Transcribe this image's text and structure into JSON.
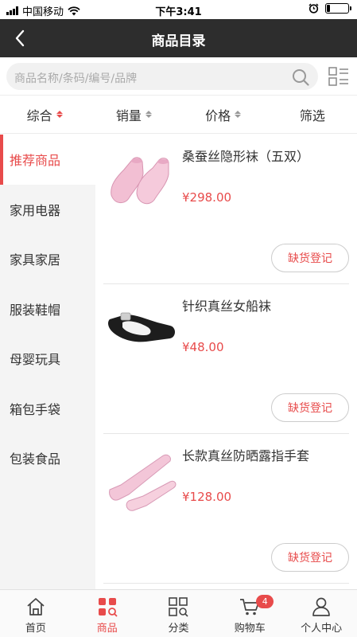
{
  "status_bar": {
    "carrier": "中国移动",
    "time": "下午3:41"
  },
  "nav": {
    "title": "商品目录"
  },
  "search": {
    "placeholder": "商品名称/条码/编号/品牌"
  },
  "sort": {
    "items": [
      {
        "label": "综合",
        "active": true
      },
      {
        "label": "销量"
      },
      {
        "label": "价格"
      },
      {
        "label": "筛选"
      }
    ]
  },
  "categories": [
    {
      "label": "推荐商品",
      "active": true
    },
    {
      "label": "家用电器"
    },
    {
      "label": "家具家居"
    },
    {
      "label": "服装鞋帽"
    },
    {
      "label": "母婴玩具"
    },
    {
      "label": "箱包手袋"
    },
    {
      "label": "包装食品"
    }
  ],
  "products": [
    {
      "name": "桑蚕丝隐形袜（五双）",
      "price": "¥298.00",
      "button": "缺货登记"
    },
    {
      "name": "针织真丝女船袜",
      "price": "¥48.00",
      "button": "缺货登记"
    },
    {
      "name": "长款真丝防晒露指手套",
      "price": "¥128.00",
      "button": "缺货登记"
    }
  ],
  "tabbar": {
    "items": [
      {
        "label": "首页"
      },
      {
        "label": "商品",
        "active": true
      },
      {
        "label": "分类"
      },
      {
        "label": "购物车",
        "badge": "4"
      },
      {
        "label": "个人中心"
      }
    ]
  },
  "colors": {
    "accent": "#e84b4b",
    "navbar": "#2d2d2d"
  }
}
